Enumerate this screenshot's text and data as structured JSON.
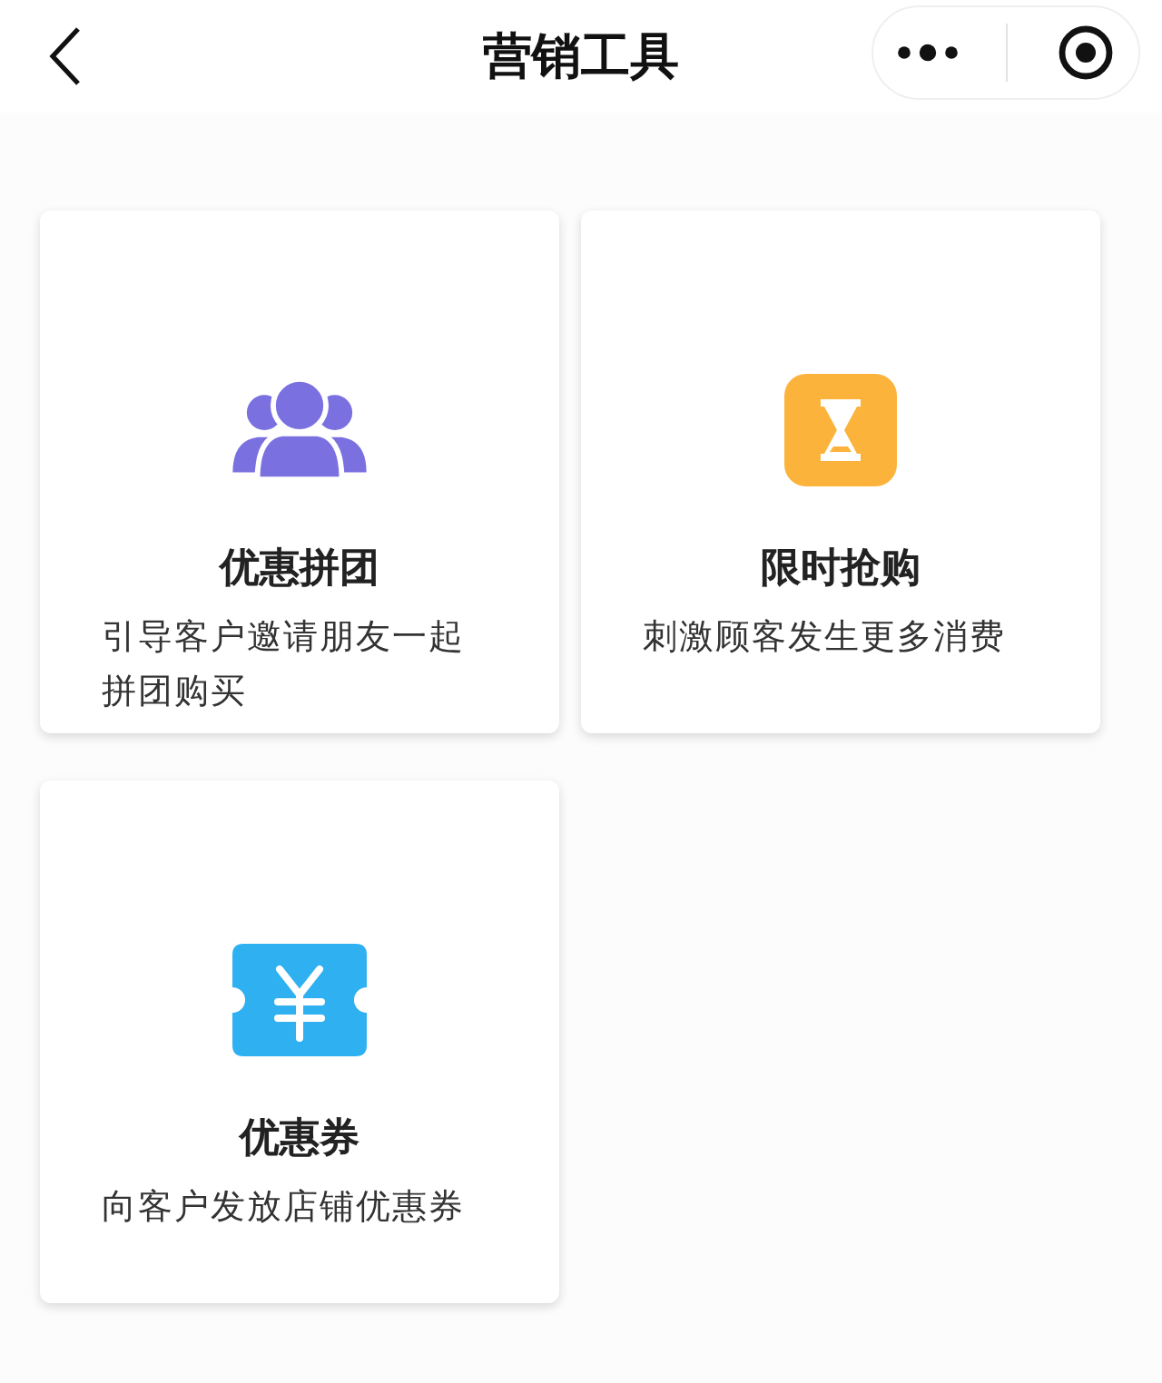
{
  "nav_bar": {
    "title": "营销工具"
  },
  "tools": [
    {
      "kind": "group",
      "color": "#7a70e0",
      "title": "优惠拼团",
      "description": "引导客户邀请朋友一起拼团购买"
    },
    {
      "kind": "hourglass",
      "color": "#fbb33c",
      "title": "限时抢购",
      "description": "刺激顾客发生更多消费"
    },
    {
      "kind": "coupon",
      "color": "#2fb0f0",
      "title": "优惠券",
      "description": "向客户发放店铺优惠券"
    }
  ]
}
